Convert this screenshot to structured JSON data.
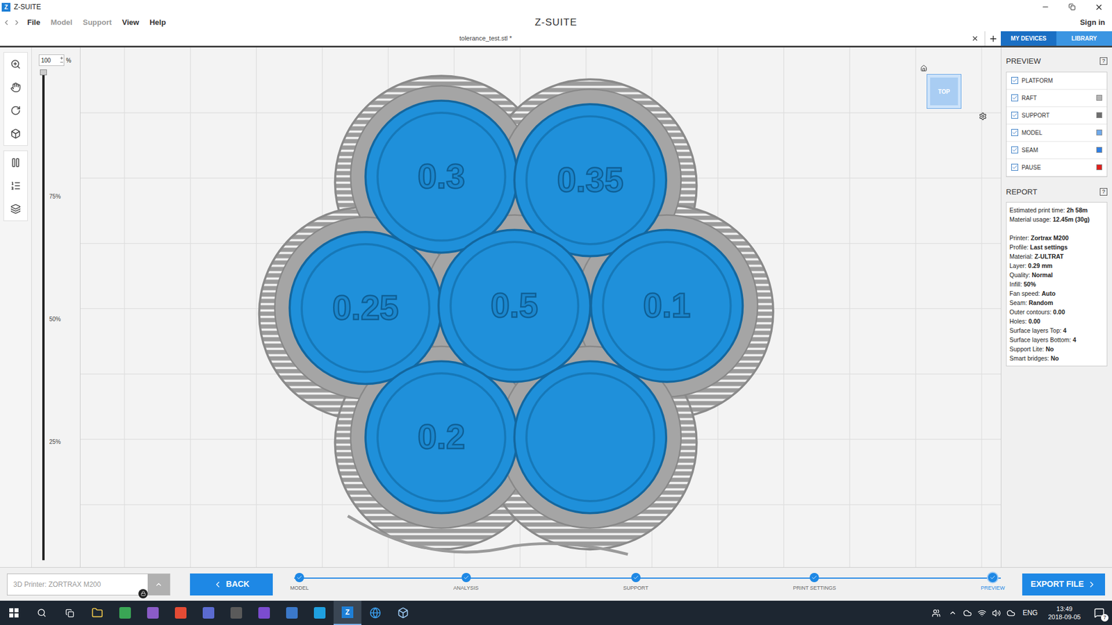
{
  "window": {
    "title": "Z-SUITE",
    "logo_letter": "Z"
  },
  "menu": [
    {
      "label": "File",
      "disabled": false
    },
    {
      "label": "Model",
      "disabled": true
    },
    {
      "label": "Support",
      "disabled": true
    },
    {
      "label": "View",
      "disabled": false
    },
    {
      "label": "Help",
      "disabled": false
    }
  ],
  "app_logo": "Z-SUITE",
  "sign_in": "Sign in",
  "document_tab": {
    "label": "tolerance_test.stl *",
    "selected": true
  },
  "side_tabs": [
    {
      "label": "MY DEVICES",
      "selected": true
    },
    {
      "label": "LIBRARY",
      "selected": false
    }
  ],
  "zoom": {
    "value": "100",
    "unit": "%"
  },
  "layer_slider": {
    "level": 1,
    "ticks": [
      {
        "label": "75%",
        "value": 0.75
      },
      {
        "label": "50%",
        "value": 0.5
      },
      {
        "label": "25%",
        "value": 0.25
      }
    ]
  },
  "view_cube": {
    "label": "TOP"
  },
  "model_labels": [
    "0.3",
    "0.35",
    "0.25",
    "0.5",
    "0.1",
    "0.2",
    ""
  ],
  "preview": {
    "title": "PREVIEW",
    "help": "?",
    "items": [
      {
        "label": "PLATFORM",
        "checked": true,
        "color": ""
      },
      {
        "label": "RAFT",
        "checked": true,
        "color": "#b4b4b4"
      },
      {
        "label": "SUPPORT",
        "checked": true,
        "color": "#6e6e6e"
      },
      {
        "label": "MODEL",
        "checked": true,
        "color": "#6fa9ea"
      },
      {
        "label": "SEAM",
        "checked": true,
        "color": "#2f7fe4"
      },
      {
        "label": "PAUSE",
        "checked": true,
        "color": "#e0201c"
      }
    ]
  },
  "report": {
    "title": "REPORT",
    "help": "?",
    "groups": [
      [
        {
          "label": "Estimated print time:",
          "value": "2h 58m"
        },
        {
          "label": "Material usage:",
          "value": "12.45m (30g)"
        }
      ],
      [
        {
          "label": "Printer:",
          "value": "Zortrax M200"
        },
        {
          "label": "Profile:",
          "value": "Last settings"
        },
        {
          "label": "Material:",
          "value": "Z-ULTRAT"
        },
        {
          "label": "Layer:",
          "value": "0.29 mm"
        },
        {
          "label": "Quality:",
          "value": "Normal"
        },
        {
          "label": "Infill:",
          "value": "50%"
        },
        {
          "label": "Fan speed:",
          "value": "Auto"
        },
        {
          "label": "Seam:",
          "value": "Random"
        },
        {
          "label": "Outer contours:",
          "value": "0.00"
        },
        {
          "label": "Holes:",
          "value": "0.00"
        },
        {
          "label": "Surface layers Top:",
          "value": "4"
        },
        {
          "label": "Surface layers Bottom:",
          "value": "4"
        },
        {
          "label": "Support Lite:",
          "value": "No"
        },
        {
          "label": "Smart bridges:",
          "value": "No"
        }
      ]
    ]
  },
  "bottom": {
    "printer_field": {
      "placeholder": "3D Printer: ZORTRAX M200",
      "locked": true
    },
    "back": "BACK",
    "steps": [
      {
        "label": "MODEL",
        "done": true,
        "selected": false
      },
      {
        "label": "ANALYSIS",
        "done": true,
        "selected": false
      },
      {
        "label": "SUPPORT",
        "done": true,
        "selected": false
      },
      {
        "label": "PRINT SETTINGS",
        "done": true,
        "selected": false
      },
      {
        "label": "PREVIEW",
        "done": true,
        "selected": true
      }
    ],
    "export": "EXPORT FILE"
  },
  "taskbar": {
    "language": "ENG",
    "time": "13:49",
    "date": "2018-09-05",
    "notifications": "7"
  }
}
